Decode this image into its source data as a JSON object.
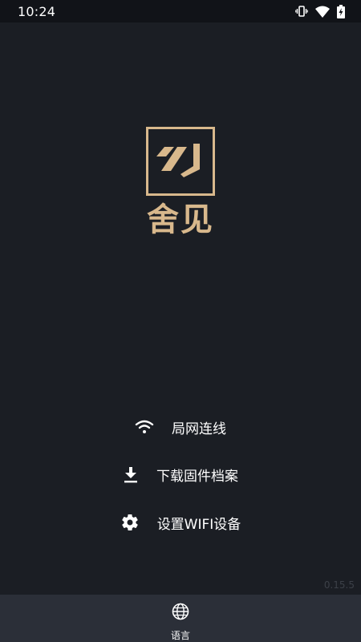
{
  "status_bar": {
    "time": "10:24",
    "icons": [
      "vibrate-icon",
      "wifi-icon",
      "battery-charging-icon"
    ]
  },
  "app": {
    "name": "舍见",
    "accent_color": "#d8b88c",
    "background_color": "#1b1e24"
  },
  "menu": {
    "items": [
      {
        "label": "局网连线",
        "icon": "wifi-icon"
      },
      {
        "label": "下载固件档案",
        "icon": "download-icon"
      },
      {
        "label": "设置WIFI设备",
        "icon": "gear-icon"
      }
    ]
  },
  "version": "0.15.5",
  "bottom_nav": {
    "language_label": "语言",
    "icon": "globe-icon"
  }
}
